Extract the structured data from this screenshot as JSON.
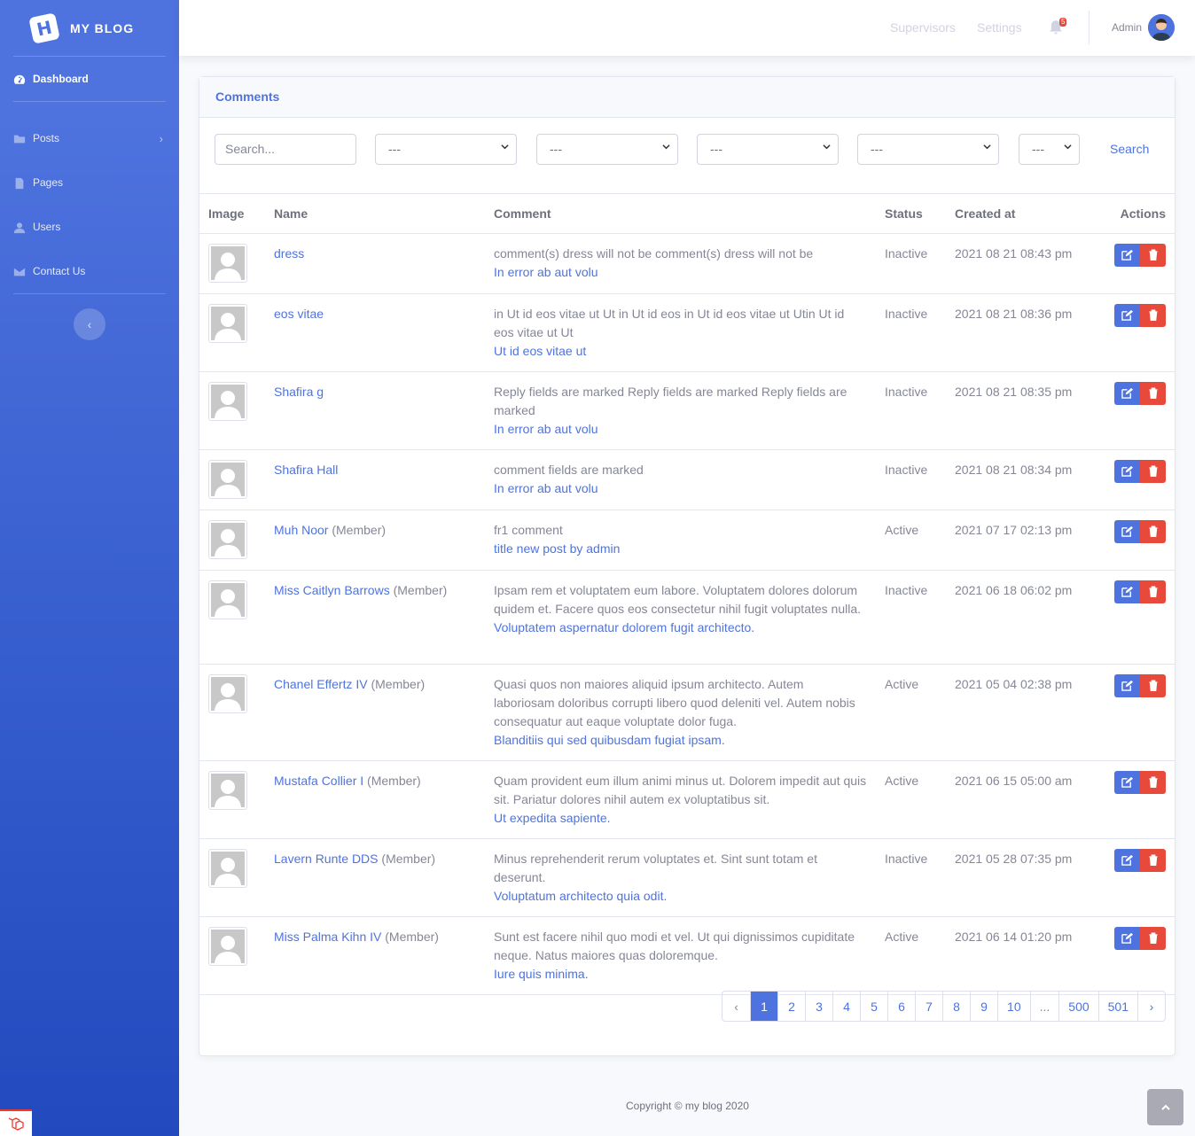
{
  "brand": {
    "logo_letter": "H",
    "name": "MY BLOG"
  },
  "sidebar": {
    "items": [
      {
        "label": "Dashboard",
        "icon": "tachometer-icon"
      },
      {
        "label": "Posts",
        "icon": "folder-icon"
      },
      {
        "label": "Pages",
        "icon": "file-icon"
      },
      {
        "label": "Users",
        "icon": "user-icon"
      },
      {
        "label": "Contact Us",
        "icon": "envelope-icon"
      }
    ],
    "toggle_glyph": "‹"
  },
  "topbar": {
    "supervisors": "Supervisors",
    "settings": "Settings",
    "notification_count": "5",
    "admin_name": "Admin"
  },
  "card": {
    "title": "Comments"
  },
  "filters": {
    "search_placeholder": "Search...",
    "select_value": "---",
    "search_button": "Search"
  },
  "table": {
    "headers": [
      "Image",
      "Name",
      "Comment",
      "Status",
      "Created at",
      "Actions"
    ],
    "rows": [
      {
        "name": "dress",
        "member": "",
        "comment": "comment(s) dress will not be comment(s) dress will not be",
        "post": "In error ab aut volu",
        "status": "Inactive",
        "created": "2021 08 21 08:43 pm"
      },
      {
        "name": "eos vitae",
        "member": "",
        "comment": "in Ut id eos vitae ut Ut in Ut id eos in Ut id eos vitae ut Utin Ut id eos vitae ut Ut",
        "post": "Ut id eos vitae ut",
        "status": "Inactive",
        "created": "2021 08 21 08:36 pm"
      },
      {
        "name": "Shafira g",
        "member": "",
        "comment": "Reply fields are marked Reply fields are marked Reply fields are marked",
        "post": "In error ab aut volu",
        "status": "Inactive",
        "created": "2021 08 21 08:35 pm"
      },
      {
        "name": "Shafira Hall",
        "member": "",
        "comment": "comment fields are marked",
        "post": "In error ab aut volu",
        "status": "Inactive",
        "created": "2021 08 21 08:34 pm"
      },
      {
        "name": "Muh Noor",
        "member": "(Member)",
        "comment": "fr1 comment",
        "post": "title new post by admin",
        "status": "Active",
        "created": "2021 07 17 02:13 pm"
      },
      {
        "name": "Miss Caitlyn Barrows",
        "member": "(Member)",
        "comment": "Ipsam rem et voluptatem eum labore. Voluptatem dolores dolorum quidem et. Facere quos eos consectetur nihil fugit voluptates nulla.",
        "post": "Voluptatem aspernatur dolorem fugit architecto.",
        "status": "Inactive",
        "created": "2021 06 18 06:02 pm"
      },
      {
        "name": "Chanel Effertz IV",
        "member": "(Member)",
        "comment": "Quasi quos non maiores aliquid ipsum architecto. Autem laboriosam doloribus corrupti libero quod deleniti vel. Autem nobis consequatur aut eaque voluptate dolor fuga.",
        "post": "Blanditiis qui sed quibusdam fugiat ipsam.",
        "status": "Active",
        "created": "2021 05 04 02:38 pm"
      },
      {
        "name": "Mustafa Collier I",
        "member": "(Member)",
        "comment": "Quam provident eum illum animi minus ut. Dolorem impedit aut quis sit. Pariatur dolores nihil autem ex voluptatibus sit.",
        "post": "Ut expedita sapiente.",
        "status": "Active",
        "created": "2021 06 15 05:00 am"
      },
      {
        "name": "Lavern Runte DDS",
        "member": "(Member)",
        "comment": "Minus reprehenderit rerum voluptates et. Sint sunt totam et deserunt.",
        "post": "Voluptatum architecto quia odit.",
        "status": "Inactive",
        "created": "2021 05 28 07:35 pm"
      },
      {
        "name": "Miss Palma Kihn IV",
        "member": "(Member)",
        "comment": "Sunt est facere nihil quo modi et vel. Ut qui dignissimos cupiditate neque. Natus maiores quas doloremque.",
        "post": "Iure quis minima.",
        "status": "Active",
        "created": "2021 06 14 01:20 pm"
      }
    ]
  },
  "pagination": [
    "‹",
    "1",
    "2",
    "3",
    "4",
    "5",
    "6",
    "7",
    "8",
    "9",
    "10",
    "...",
    "500",
    "501",
    "›"
  ],
  "pagination_active": "1",
  "footer": {
    "copyright": "Copyright © my blog 2020"
  },
  "colors": {
    "primary": "#4e73df",
    "danger": "#e74a3b",
    "text_muted": "#858796"
  }
}
